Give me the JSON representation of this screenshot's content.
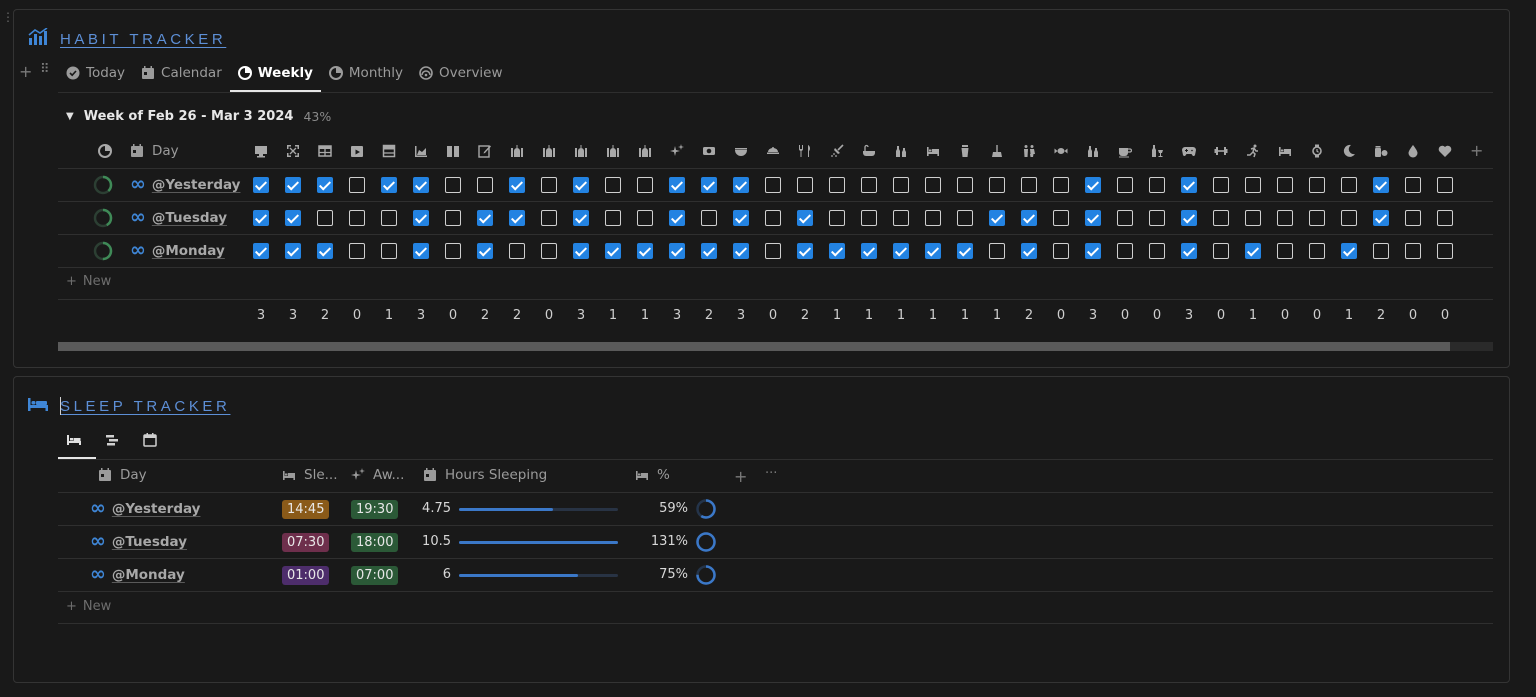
{
  "habit": {
    "title": "HABIT TRACKER",
    "title_icon": "chart-icon",
    "tabs": [
      {
        "label": "Today",
        "icon": "check-circle-icon"
      },
      {
        "label": "Calendar",
        "icon": "calendar-icon"
      },
      {
        "label": "Weekly",
        "icon": "pie-icon",
        "active": true
      },
      {
        "label": "Monthly",
        "icon": "pie-icon"
      },
      {
        "label": "Overview",
        "icon": "gauge-icon"
      }
    ],
    "group": {
      "name": "Week of Feb 26 - Mar 3 2024",
      "percent": "43%"
    },
    "day_header": "Day",
    "habit_icons": [
      "computer-icon",
      "expand-icon",
      "table-icon",
      "play-icon",
      "layout-icon",
      "area-chart-icon",
      "book-icon",
      "edit-icon",
      "mosque-icon",
      "mosque-icon",
      "mosque-icon",
      "mosque-icon",
      "mosque-icon",
      "sparkle-icon",
      "eye-icon",
      "bowl-icon",
      "dish-icon",
      "cutlery-icon",
      "shower-icon",
      "bath-icon",
      "bottles-icon",
      "bed-icon",
      "cup-icon",
      "broom-icon",
      "people-icon",
      "candy-icon",
      "bottles-icon",
      "coffee-icon",
      "bottle-glass-icon",
      "gamepad-icon",
      "dumbbell-icon",
      "run-icon",
      "bed-icon",
      "watch-icon",
      "moon-icon",
      "pills-icon",
      "drop-icon",
      "heart-icon"
    ],
    "rows": [
      {
        "label": "@Yesterday",
        "progress": 0.38,
        "checks": [
          1,
          1,
          1,
          0,
          1,
          1,
          0,
          0,
          1,
          0,
          1,
          0,
          0,
          1,
          1,
          1,
          0,
          0,
          0,
          0,
          0,
          0,
          0,
          0,
          0,
          0,
          1,
          0,
          0,
          1,
          0,
          0,
          0,
          0,
          0,
          1,
          0,
          0
        ]
      },
      {
        "label": "@Tuesday",
        "progress": 0.42,
        "checks": [
          1,
          1,
          0,
          0,
          0,
          1,
          0,
          1,
          1,
          0,
          1,
          0,
          0,
          1,
          0,
          1,
          0,
          1,
          0,
          0,
          0,
          0,
          0,
          1,
          1,
          0,
          1,
          0,
          0,
          1,
          0,
          0,
          0,
          0,
          0,
          1,
          0,
          0
        ]
      },
      {
        "label": "@Monday",
        "progress": 0.5,
        "checks": [
          1,
          1,
          1,
          0,
          0,
          1,
          0,
          1,
          0,
          0,
          1,
          1,
          1,
          1,
          1,
          1,
          0,
          1,
          1,
          1,
          1,
          1,
          1,
          0,
          1,
          0,
          1,
          0,
          0,
          1,
          0,
          1,
          0,
          0,
          1,
          0,
          0,
          0
        ]
      }
    ],
    "totals": [
      3,
      3,
      2,
      0,
      1,
      3,
      0,
      2,
      2,
      0,
      3,
      1,
      1,
      3,
      2,
      3,
      0,
      2,
      1,
      1,
      1,
      1,
      1,
      1,
      2,
      0,
      3,
      0,
      0,
      3,
      0,
      1,
      0,
      0,
      1,
      2,
      0,
      0
    ],
    "new_label": "New",
    "scroll": {
      "position": 0.97
    }
  },
  "sleep": {
    "title": "SLEEP TRACKER",
    "title_icon": "bed-icon",
    "headers": {
      "day": "Day",
      "sleep": "Sle...",
      "awake": "Aw...",
      "hours": "Hours Sleeping",
      "percent": "%"
    },
    "rows": [
      {
        "label": "@Yesterday",
        "sleep": "14:45",
        "sleep_color": "#8a5a19",
        "awake": "19:30",
        "awake_color": "#2b5937",
        "hours": "4.75",
        "hours_fill": 0.59,
        "pct": "59%",
        "pct_value": 0.59
      },
      {
        "label": "@Tuesday",
        "sleep": "07:30",
        "sleep_color": "#6e2f4c",
        "awake": "18:00",
        "awake_color": "#2b5937",
        "hours": "10.5",
        "hours_fill": 1.0,
        "pct": "131%",
        "pct_value": 1.0
      },
      {
        "label": "@Monday",
        "sleep": "01:00",
        "sleep_color": "#4d2d6b",
        "awake": "07:00",
        "awake_color": "#2b5937",
        "hours": "6",
        "hours_fill": 0.75,
        "pct": "75%",
        "pct_value": 0.75
      }
    ],
    "new_label": "New",
    "colors": {
      "accent": "#2383e2",
      "bar": "#3b78c8"
    }
  }
}
